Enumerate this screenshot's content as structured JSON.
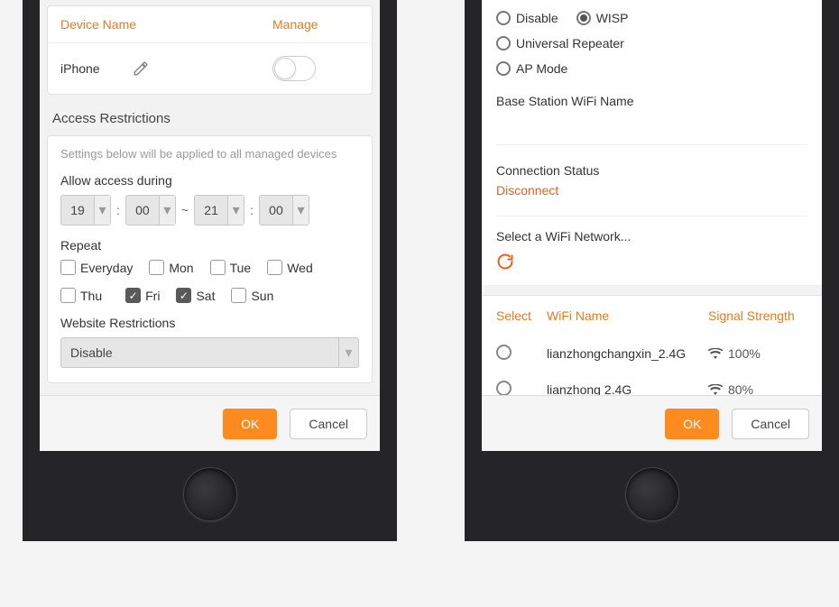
{
  "left": {
    "device_table": {
      "header_name": "Device Name",
      "header_manage": "Manage",
      "row": {
        "name": "iPhone"
      }
    },
    "access_restrictions_title": "Access Restrictions",
    "hint": "Settings below will be applied to all managed devices",
    "allow_access_label": "Allow access during",
    "time": {
      "h1": "19",
      "m1": "00",
      "h2": "21",
      "m2": "00"
    },
    "repeat_label": "Repeat",
    "days": [
      {
        "label": "Everyday",
        "checked": false
      },
      {
        "label": "Mon",
        "checked": false
      },
      {
        "label": "Tue",
        "checked": false
      },
      {
        "label": "Wed",
        "checked": false
      },
      {
        "label": "Thu",
        "checked": false
      },
      {
        "label": "Fri",
        "checked": true
      },
      {
        "label": "Sat",
        "checked": true
      },
      {
        "label": "Sun",
        "checked": false
      }
    ],
    "website_restrictions_label": "Website Restrictions",
    "website_restrictions_value": "Disable",
    "ok_label": "OK",
    "cancel_label": "Cancel"
  },
  "right": {
    "modes": {
      "disable": "Disable",
      "wisp": "WISP",
      "universal_repeater": "Universal Repeater",
      "ap_mode": "AP Mode",
      "selected": "wisp"
    },
    "base_station_label": "Base Station WiFi Name",
    "connection_status_label": "Connection Status",
    "connection_status_value": "Disconnect",
    "select_network_label": "Select a WiFi Network...",
    "wifi_table": {
      "header_select": "Select",
      "header_name": "WiFi Name",
      "header_signal": "Signal Strength",
      "rows": [
        {
          "name": "lianzhongchangxin_2.4G",
          "signal": "100%"
        },
        {
          "name": "lianzhong 2.4G",
          "signal": "80%"
        }
      ]
    },
    "ok_label": "OK",
    "cancel_label": "Cancel"
  }
}
